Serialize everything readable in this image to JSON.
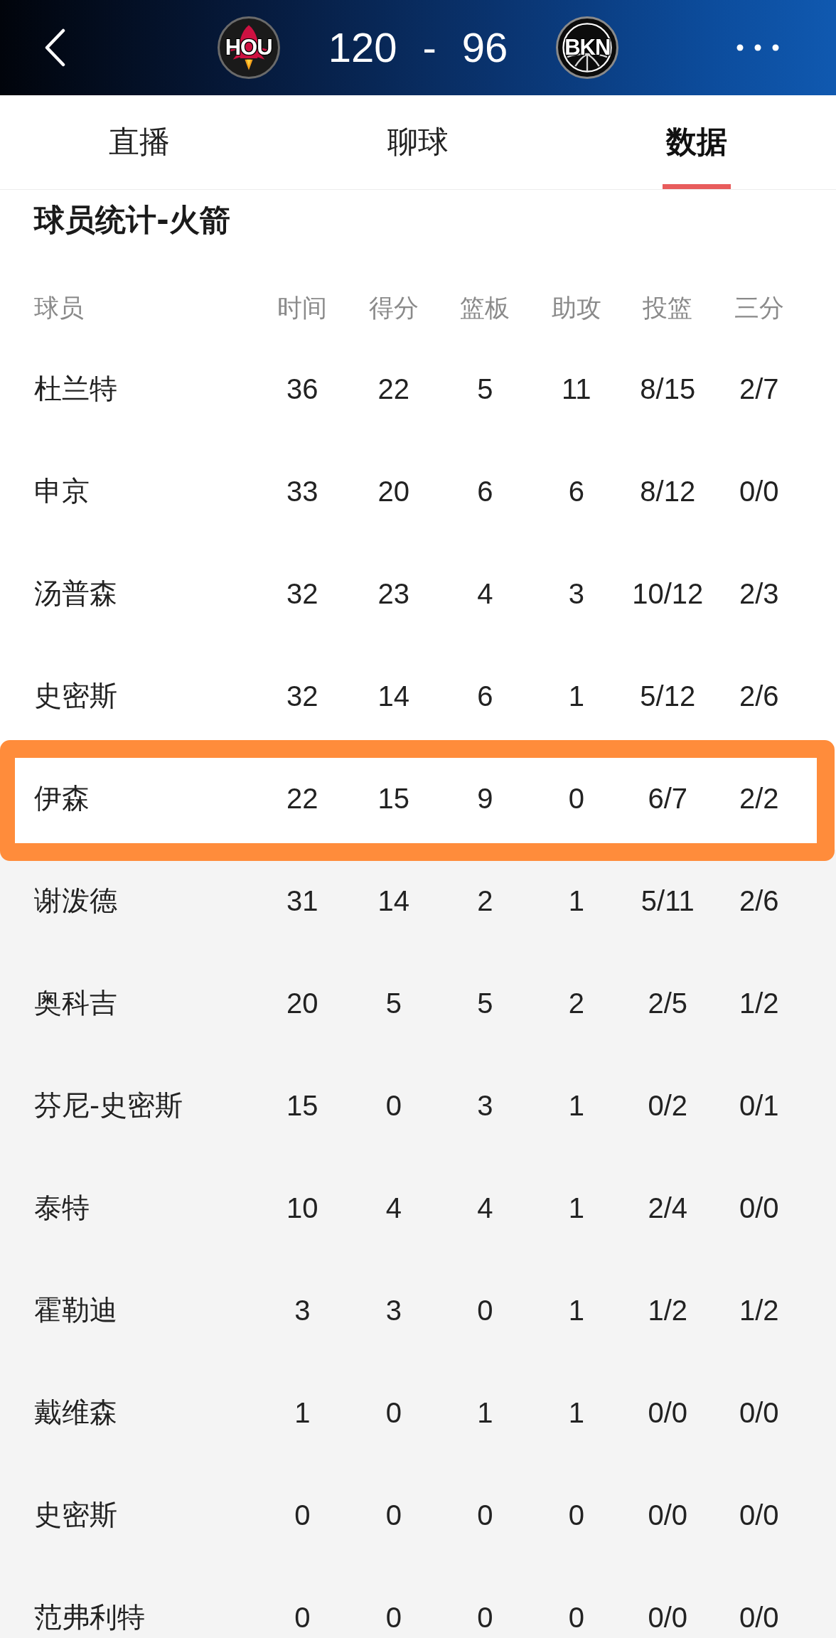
{
  "header": {
    "home_team": {
      "abbreviation": "HOU",
      "kind": "rocket"
    },
    "home_score": "120",
    "separator": "-",
    "away_score": "96",
    "away_team": {
      "abbreviation": "BKN",
      "kind": "ball"
    }
  },
  "tabs": [
    {
      "label": "直播",
      "selected": false
    },
    {
      "label": "聊球",
      "selected": false
    },
    {
      "label": "数据",
      "selected": true
    }
  ],
  "section_title": "球员统计-火箭",
  "table": {
    "columns": [
      "球员",
      "时间",
      "得分",
      "篮板",
      "助攻",
      "投篮",
      "三分"
    ],
    "rows": [
      {
        "player": "杜兰特",
        "stats": [
          "36",
          "22",
          "5",
          "11",
          "8/15",
          "2/7"
        ],
        "highlighted": false
      },
      {
        "player": "申京",
        "stats": [
          "33",
          "20",
          "6",
          "6",
          "8/12",
          "0/0"
        ],
        "highlighted": false
      },
      {
        "player": "汤普森",
        "stats": [
          "32",
          "23",
          "4",
          "3",
          "10/12",
          "2/3"
        ],
        "highlighted": false
      },
      {
        "player": "史密斯",
        "stats": [
          "32",
          "14",
          "6",
          "1",
          "5/12",
          "2/6"
        ],
        "highlighted": false
      },
      {
        "player": "伊森",
        "stats": [
          "22",
          "15",
          "9",
          "0",
          "6/7",
          "2/2"
        ],
        "highlighted": true
      },
      {
        "player": "谢泼德",
        "stats": [
          "31",
          "14",
          "2",
          "1",
          "5/11",
          "2/6"
        ],
        "highlighted": false
      },
      {
        "player": "奥科吉",
        "stats": [
          "20",
          "5",
          "5",
          "2",
          "2/5",
          "1/2"
        ],
        "highlighted": false
      },
      {
        "player": "芬尼-史密斯",
        "stats": [
          "15",
          "0",
          "3",
          "1",
          "0/2",
          "0/1"
        ],
        "highlighted": false
      },
      {
        "player": "泰特",
        "stats": [
          "10",
          "4",
          "4",
          "1",
          "2/4",
          "0/0"
        ],
        "highlighted": false
      },
      {
        "player": "霍勒迪",
        "stats": [
          "3",
          "3",
          "0",
          "1",
          "1/2",
          "1/2"
        ],
        "highlighted": false
      },
      {
        "player": "戴维森",
        "stats": [
          "1",
          "0",
          "1",
          "1",
          "0/0",
          "0/0"
        ],
        "highlighted": false
      },
      {
        "player": "史密斯",
        "stats": [
          "0",
          "0",
          "0",
          "0",
          "0/0",
          "0/0"
        ],
        "highlighted": false
      },
      {
        "player": "范弗利特",
        "stats": [
          "0",
          "0",
          "0",
          "0",
          "0/0",
          "0/0"
        ],
        "highlighted": false
      }
    ]
  }
}
